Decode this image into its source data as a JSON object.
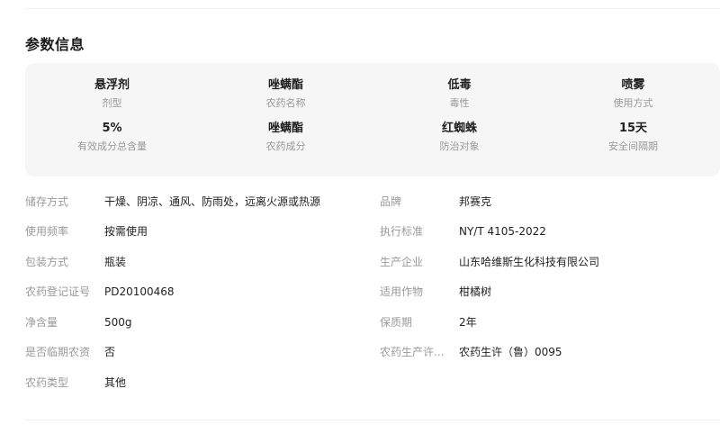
{
  "section": {
    "title": "参数信息"
  },
  "summary": [
    {
      "value": "悬浮剂",
      "label": "剂型"
    },
    {
      "value": "唑螨酯",
      "label": "农药名称"
    },
    {
      "value": "低毒",
      "label": "毒性"
    },
    {
      "value": "喷雾",
      "label": "使用方式"
    },
    {
      "value": "5%",
      "label": "有效成分总含量"
    },
    {
      "value": "唑螨酯",
      "label": "农药成分"
    },
    {
      "value": "红蜘蛛",
      "label": "防治对象"
    },
    {
      "value": "15天",
      "label": "安全间隔期"
    }
  ],
  "details_left": [
    {
      "label": "储存方式",
      "value": "干燥、阴凉、通风、防雨处，远离火源或热源"
    },
    {
      "label": "使用频率",
      "value": "按需使用"
    },
    {
      "label": "包装方式",
      "value": "瓶装"
    },
    {
      "label": "农药登记证号",
      "value": "PD20100468"
    },
    {
      "label": "净含量",
      "value": "500g"
    },
    {
      "label": "是否临期农资",
      "value": "否"
    },
    {
      "label": "农药类型",
      "value": "其他"
    }
  ],
  "details_right": [
    {
      "label": "品牌",
      "value": "邦赛克"
    },
    {
      "label": "执行标准",
      "value": "NY/T 4105-2022"
    },
    {
      "label": "生产企业",
      "value": "山东哈维斯生化科技有限公司"
    },
    {
      "label": "适用作物",
      "value": "柑橘树"
    },
    {
      "label": "保质期",
      "value": "2年"
    },
    {
      "label": "农药生产许...",
      "value": "农药生许（鲁）0095"
    }
  ]
}
